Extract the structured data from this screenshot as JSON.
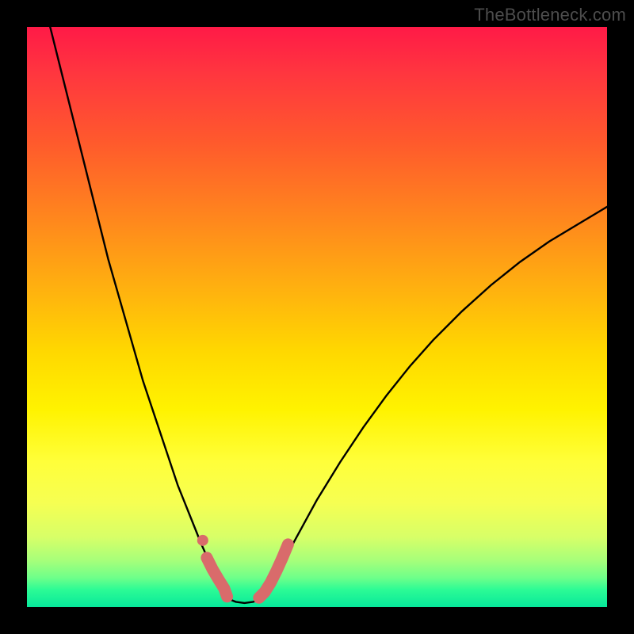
{
  "brand_text": "TheBottleneck.com",
  "chart_data": {
    "type": "line",
    "title": "",
    "xlabel": "",
    "ylabel": "",
    "xlim": [
      0,
      100
    ],
    "ylim": [
      0,
      100
    ],
    "series": [
      {
        "name": "left-curve",
        "x": [
          4,
          6,
          8,
          10,
          12,
          14,
          16,
          18,
          20,
          22,
          24,
          26,
          28,
          30,
          32,
          33.5,
          34.5
        ],
        "y": [
          100,
          92,
          84,
          76,
          68,
          60,
          53,
          46,
          39,
          33,
          27,
          21,
          16,
          11,
          6.5,
          3.5,
          1.5
        ]
      },
      {
        "name": "bottom-flat",
        "x": [
          34.5,
          36,
          37.5,
          39,
          40.5
        ],
        "y": [
          1.5,
          0.9,
          0.7,
          0.9,
          1.5
        ]
      },
      {
        "name": "right-curve",
        "x": [
          40.5,
          42,
          44,
          47,
          50,
          54,
          58,
          62,
          66,
          70,
          75,
          80,
          85,
          90,
          95,
          100
        ],
        "y": [
          1.5,
          3.5,
          7.5,
          13,
          18.5,
          25,
          31,
          36.5,
          41.5,
          46,
          51,
          55.5,
          59.5,
          63,
          66,
          69
        ]
      },
      {
        "name": "marker-band-left",
        "x": [
          31,
          32,
          33,
          34,
          34.5
        ],
        "y": [
          8.5,
          6.5,
          4.8,
          3.2,
          1.8
        ]
      },
      {
        "name": "marker-band-right",
        "x": [
          40,
          41,
          42,
          43,
          44,
          45
        ],
        "y": [
          1.6,
          2.6,
          4.2,
          6.2,
          8.4,
          10.8
        ]
      },
      {
        "name": "isolated-dot",
        "x": [
          30.3
        ],
        "y": [
          11.5
        ]
      }
    ],
    "legend": null,
    "grid": false
  },
  "colors": {
    "curve": "#000000",
    "marker": "#d96b6b",
    "isolated_dot": "#d96b6b"
  }
}
